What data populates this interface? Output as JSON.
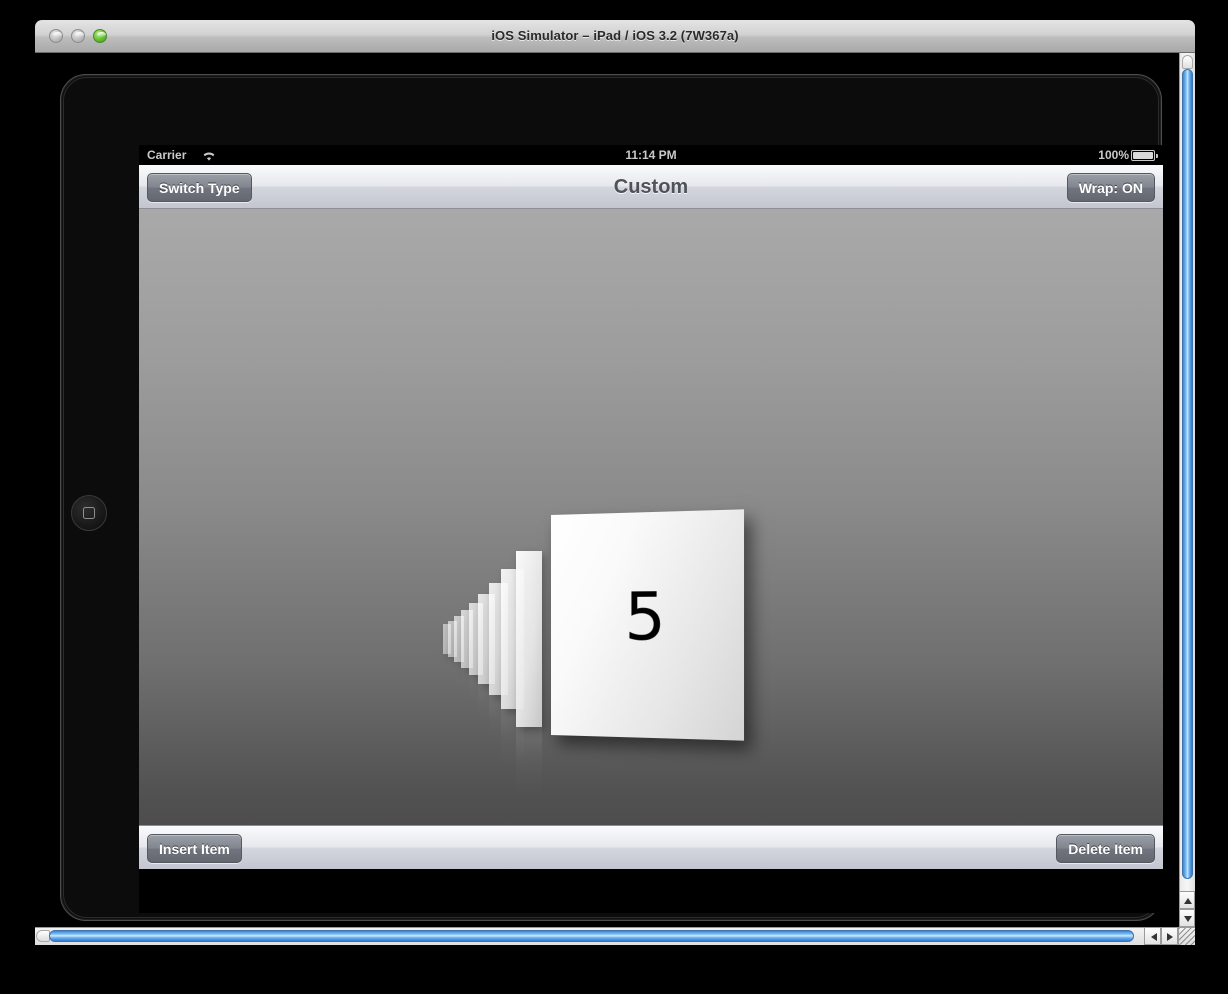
{
  "window": {
    "title": "iOS Simulator – iPad / iOS 3.2 (7W367a)",
    "traffic_lights": [
      {
        "name": "close",
        "state": "disabled",
        "color": "#b4b4b4"
      },
      {
        "name": "minimize",
        "state": "disabled",
        "color": "#b4b4b4"
      },
      {
        "name": "zoom",
        "state": "enabled",
        "color": "#64c132"
      }
    ]
  },
  "device": {
    "model": "iPad",
    "orientation": "landscape",
    "home_button_icon": "home-button-icon"
  },
  "status_bar": {
    "carrier": "Carrier",
    "wifi_icon": "wifi-icon",
    "time": "11:14 PM",
    "battery_percent": "100%",
    "battery_icon": "battery-full-icon"
  },
  "nav_bar": {
    "title": "Custom",
    "left_button": "Switch Type",
    "right_button": "Wrap: ON"
  },
  "bottom_bar": {
    "left_button": "Insert Item",
    "right_button": "Delete Item"
  },
  "carousel": {
    "type": "cylinder-inverted-perspective",
    "background_top_color": "#a9a9a9",
    "background_bottom_color": "#474747",
    "front_item_label": "5",
    "items": [
      {
        "label": "5",
        "depth": 0
      },
      {
        "label": "",
        "depth": 1
      },
      {
        "label": "",
        "depth": 2
      },
      {
        "label": "",
        "depth": 3
      },
      {
        "label": "",
        "depth": 4
      },
      {
        "label": "",
        "depth": 5
      },
      {
        "label": "",
        "depth": 6
      },
      {
        "label": "",
        "depth": 7
      },
      {
        "label": "",
        "depth": 8
      },
      {
        "label": "",
        "depth": 9
      }
    ],
    "reflections_enabled": true
  },
  "scrollbars": {
    "vertical_icon": "vertical-scrollbar",
    "horizontal_icon": "horizontal-scrollbar",
    "up_arrow_icon": "scroll-up-arrow-icon",
    "down_arrow_icon": "scroll-down-arrow-icon",
    "left_arrow_icon": "scroll-left-arrow-icon",
    "right_arrow_icon": "scroll-right-arrow-icon",
    "resize_grip_icon": "resize-grip-icon",
    "thumb_color": "#3a86d8"
  }
}
